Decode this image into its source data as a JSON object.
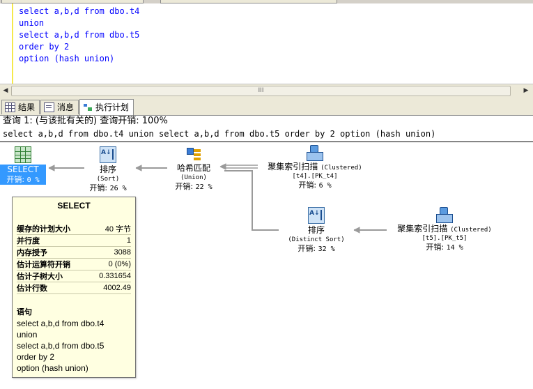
{
  "editor": {
    "code_lines": [
      "select a,b,d from dbo.t4",
      "union",
      "select a,b,d from dbo.t5",
      "order by 2",
      "option (hash union)"
    ]
  },
  "result_tabs": [
    {
      "label": "结果",
      "icon": "grid-icon"
    },
    {
      "label": "消息",
      "icon": "message-icon"
    },
    {
      "label": "执行计划",
      "icon": "execution-plan-icon"
    }
  ],
  "plan": {
    "query_header": "查询 1: (与该批有关的) 查询开销: 100%",
    "query_text": "select a,b,d from dbo.t4 union select a,b,d from dbo.t5 order by 2 option (hash union)",
    "cost_prefix": "开销:",
    "operators": {
      "select": {
        "name": "SELECT",
        "cost": "0 %"
      },
      "sort1": {
        "name": "排序",
        "sub": "(Sort)",
        "cost": "26 %"
      },
      "hash": {
        "name": "哈希匹配",
        "sub": "(Union)",
        "cost": "22 %"
      },
      "scan_t4": {
        "name": "聚集索引扫描",
        "kind": "(Clustered)",
        "sub": "[t4].[PK_t4]",
        "cost": "6 %"
      },
      "sort2": {
        "name": "排序",
        "sub": "(Distinct Sort)",
        "cost": "32 %"
      },
      "scan_t5": {
        "name": "聚集索引扫描",
        "kind": "(Clustered)",
        "sub": "[t5].[PK_t5]",
        "cost": "14 %"
      }
    }
  },
  "tooltip": {
    "title": "SELECT",
    "rows": [
      {
        "key": "缓存的计划大小",
        "value": "40 字节"
      },
      {
        "key": "并行度",
        "value": "1"
      },
      {
        "key": "内存授予",
        "value": "3088"
      },
      {
        "key": "估计运算符开销",
        "value": "0 (0%)"
      },
      {
        "key": "估计子树大小",
        "value": "0.331654"
      },
      {
        "key": "估计行数",
        "value": "4002.49"
      }
    ],
    "statement_label": "语句",
    "statement": "select a,b,d from dbo.t4\nunion\nselect a,b,d from dbo.t5\norder by 2\noption (hash union)"
  },
  "colors": {
    "selected": "#3399ff",
    "tooltip_bg": "#ffffe1",
    "keyword": "#0000ff"
  }
}
